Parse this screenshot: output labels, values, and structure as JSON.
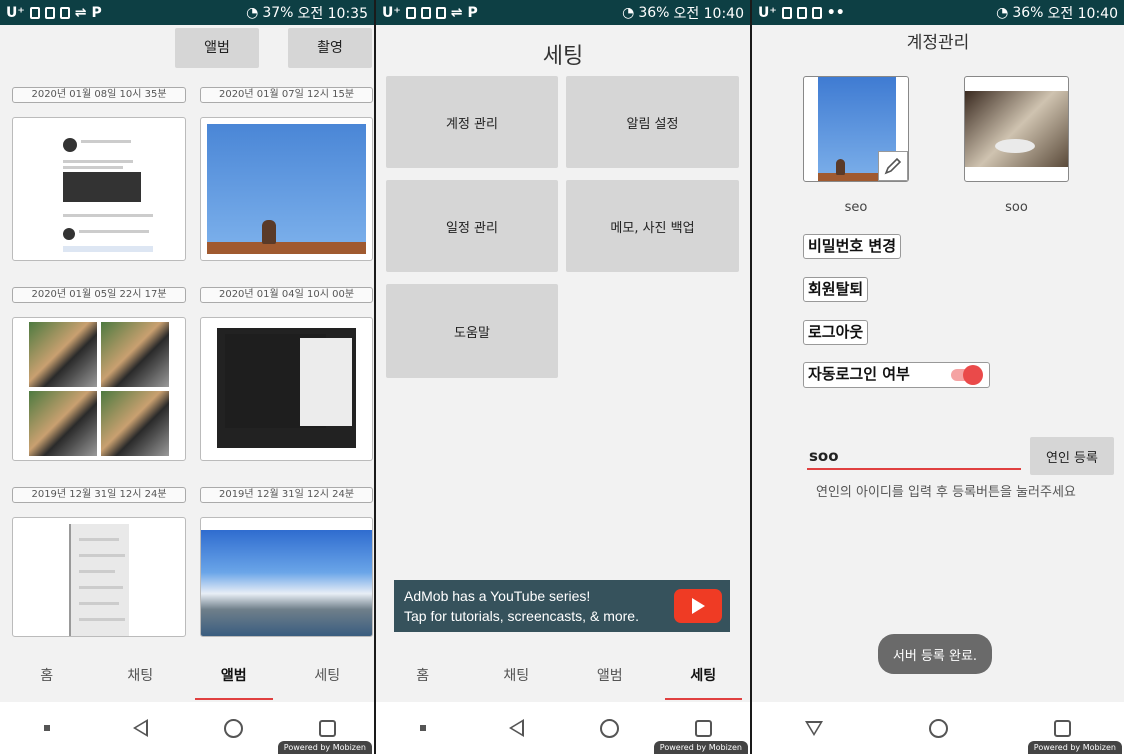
{
  "panel1": {
    "status": {
      "carrier": "U⁺",
      "battery": "37%",
      "time": "오전 10:35"
    },
    "album_button": "앨범",
    "camera_button": "촬영",
    "entries": [
      {
        "date": "2020년 01월 08일 10시 35분"
      },
      {
        "date": "2020년 01월 07일 12시 15분"
      },
      {
        "date": "2020년 01월 05일 22시 17분"
      },
      {
        "date": "2020년 01월 04일 10시 00분"
      },
      {
        "date": "2019년 12월 31일 12시 24분"
      },
      {
        "date": "2019년 12월 31일 12시 24분"
      }
    ],
    "tabs": [
      "홈",
      "채팅",
      "앨범",
      "세팅"
    ],
    "powered": "Powered by Mobizen"
  },
  "panel2": {
    "status": {
      "carrier": "U⁺",
      "battery": "36%",
      "time": "오전 10:40"
    },
    "title": "세팅",
    "menu": [
      "계정 관리",
      "알림 설정",
      "일정 관리",
      "메모, 사진 백업",
      "도움말"
    ],
    "ad": {
      "line1": "AdMob has a YouTube series!",
      "line2": "Tap for tutorials, screencasts, & more."
    },
    "tabs": [
      "홈",
      "채팅",
      "앨범",
      "세팅"
    ],
    "powered": "Powered by Mobizen"
  },
  "panel3": {
    "status": {
      "carrier": "U⁺",
      "battery": "36%",
      "time": "오전 10:40"
    },
    "title": "계정관리",
    "users": [
      "seo",
      "soo"
    ],
    "actions": [
      "비밀번호 변경",
      "회원탈퇴",
      "로그아웃"
    ],
    "auto_login": "자동로그인 여부",
    "auto_login_on": true,
    "partner_input": "soo",
    "register_button": "연인 등록",
    "hint": "연인의 아이디를 입력 후 등록버튼을 눌러주세요",
    "toast": "서버 등록 완료.",
    "powered": "Powered by Mobizen"
  }
}
